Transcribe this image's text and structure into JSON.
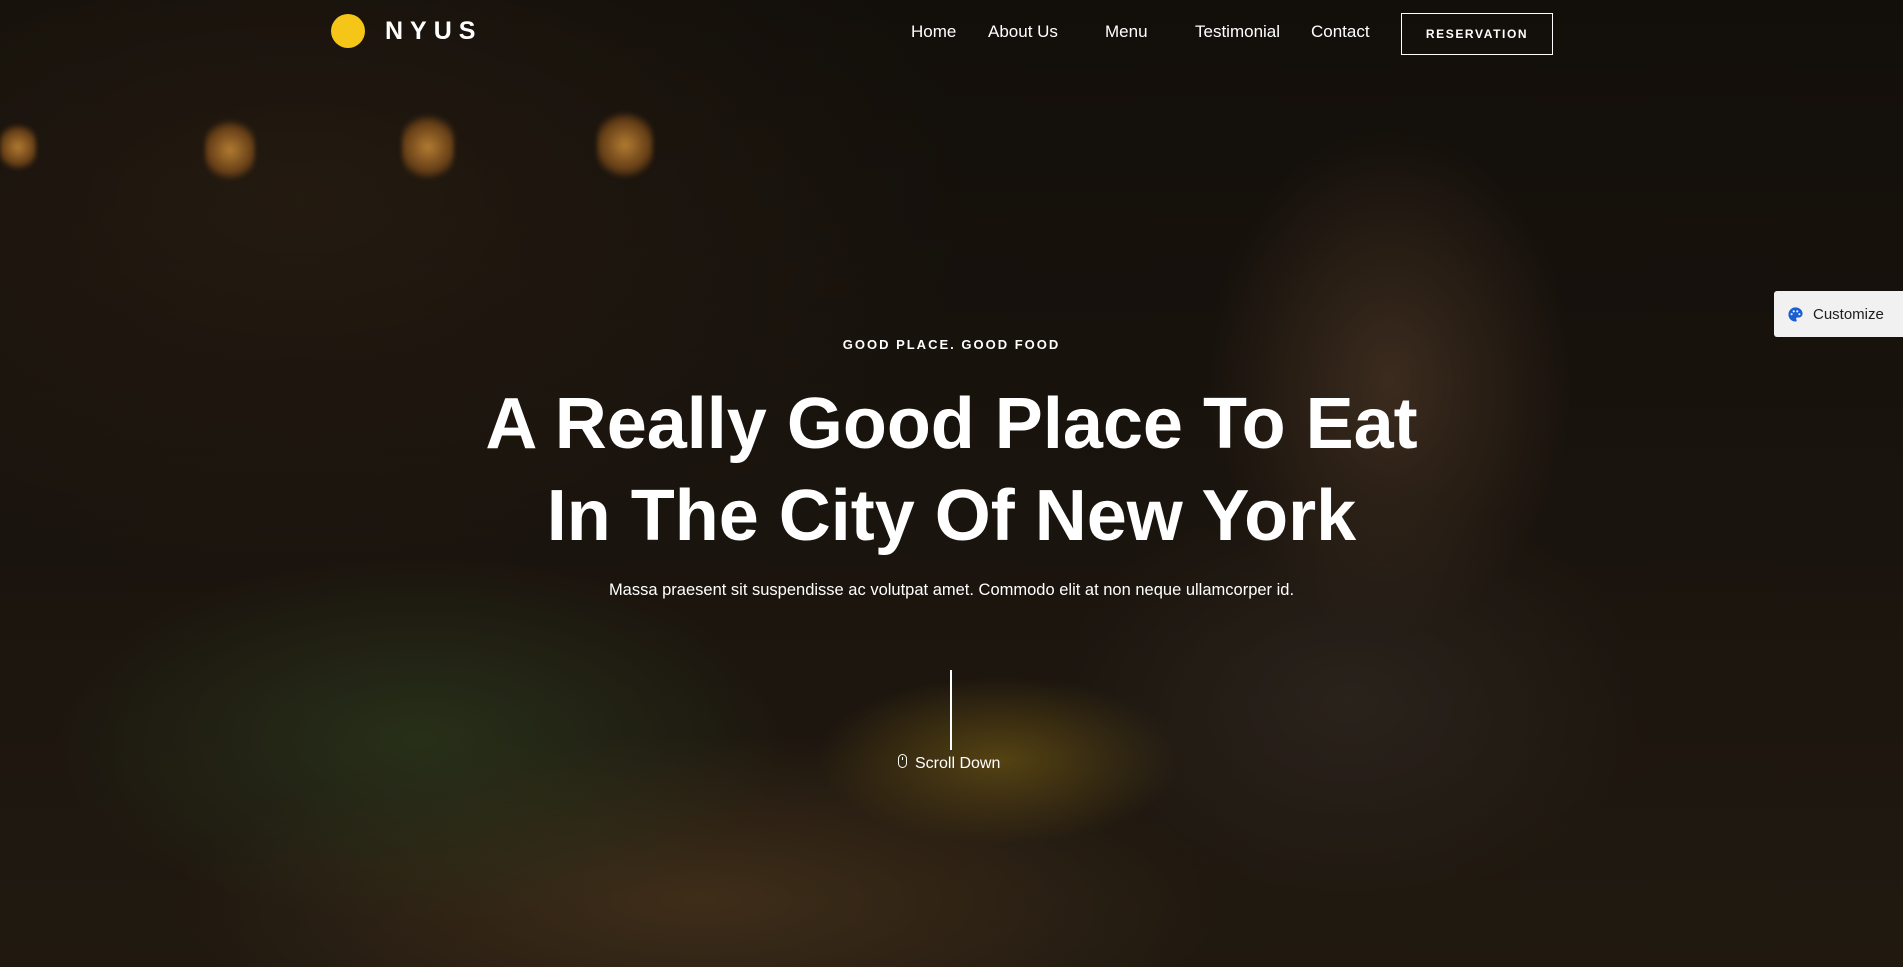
{
  "brand": {
    "name": "NYUS",
    "accent_color": "#f5c518"
  },
  "nav": {
    "items": [
      {
        "label": "Home"
      },
      {
        "label": "About Us"
      },
      {
        "label": "Menu"
      },
      {
        "label": "Testimonial"
      },
      {
        "label": "Contact"
      }
    ],
    "cta_label": "RESERVATION"
  },
  "customize": {
    "label": "Customize",
    "icon": "palette-icon",
    "icon_color": "#1a5fd1"
  },
  "hero": {
    "eyebrow": "GOOD PLACE. GOOD FOOD",
    "headline_line1": "A Really Good Place To Eat",
    "headline_line2": "In The City Of New York",
    "subtext": "Massa praesent sit suspendisse ac volutpat amet. Commodo elit at non neque ullamcorper id.",
    "scroll_label": "Scroll Down",
    "scroll_icon": "mouse-icon"
  }
}
